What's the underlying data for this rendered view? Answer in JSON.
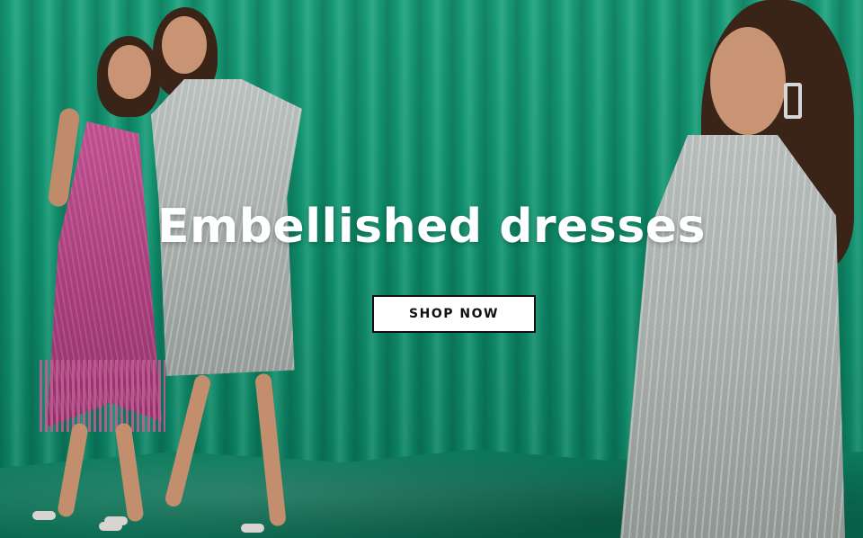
{
  "hero": {
    "headline": "Embellished dresses",
    "cta_label": "SHOP NOW"
  },
  "colors": {
    "backdrop": "#0f8f6c",
    "headline_text": "#ffffff",
    "button_bg": "#ffffff",
    "button_border": "#111111"
  }
}
